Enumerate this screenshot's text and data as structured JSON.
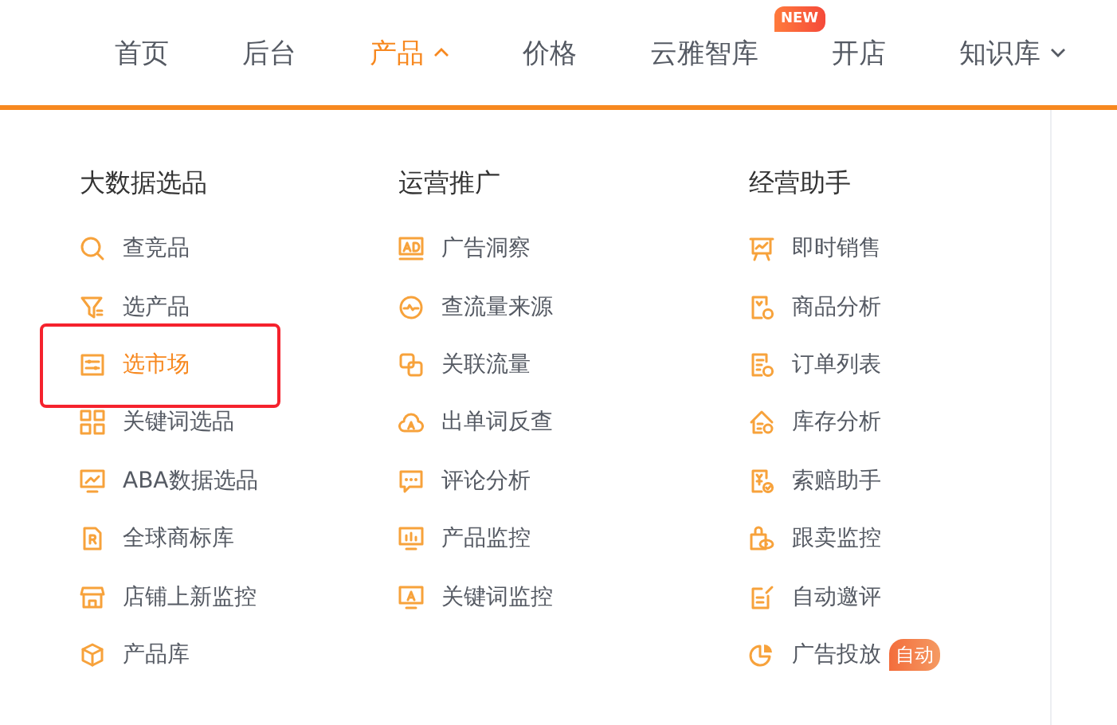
{
  "nav": [
    {
      "label": "首页",
      "selected": false
    },
    {
      "label": "后台",
      "selected": false
    },
    {
      "label": "产品",
      "selected": true,
      "dropdown": true,
      "expanded": true
    },
    {
      "label": "价格",
      "selected": false
    },
    {
      "label": "云雅智库",
      "selected": false,
      "badge": "NEW"
    },
    {
      "label": "开店",
      "selected": false
    },
    {
      "label": "知识库",
      "selected": false,
      "dropdown": true,
      "expanded": false
    }
  ],
  "menu": {
    "columns": [
      {
        "title": "大数据选品",
        "items": [
          {
            "label": "查竞品",
            "selected": false
          },
          {
            "label": "选产品",
            "selected": false
          },
          {
            "label": "选市场",
            "selected": true
          },
          {
            "label": "关键词选品",
            "selected": false
          },
          {
            "label": "ABA数据选品",
            "selected": false
          },
          {
            "label": "全球商标库",
            "selected": false
          },
          {
            "label": "店铺上新监控",
            "selected": false
          },
          {
            "label": "产品库",
            "selected": false
          }
        ]
      },
      {
        "title": "运营推广",
        "items": [
          {
            "label": "广告洞察",
            "selected": false
          },
          {
            "label": "查流量来源",
            "selected": false
          },
          {
            "label": "关联流量",
            "selected": false
          },
          {
            "label": "出单词反查",
            "selected": false
          },
          {
            "label": "评论分析",
            "selected": false
          },
          {
            "label": "产品监控",
            "selected": false
          },
          {
            "label": "关键词监控",
            "selected": false
          }
        ]
      },
      {
        "title": "经营助手",
        "items": [
          {
            "label": "即时销售",
            "selected": false
          },
          {
            "label": "商品分析",
            "selected": false
          },
          {
            "label": "订单列表",
            "selected": false
          },
          {
            "label": "库存分析",
            "selected": false
          },
          {
            "label": "索赔助手",
            "selected": false
          },
          {
            "label": "跟卖监控",
            "selected": false
          },
          {
            "label": "自动邀评",
            "selected": false
          },
          {
            "label": "广告投放",
            "selected": false,
            "badge": "自动"
          }
        ]
      }
    ]
  }
}
